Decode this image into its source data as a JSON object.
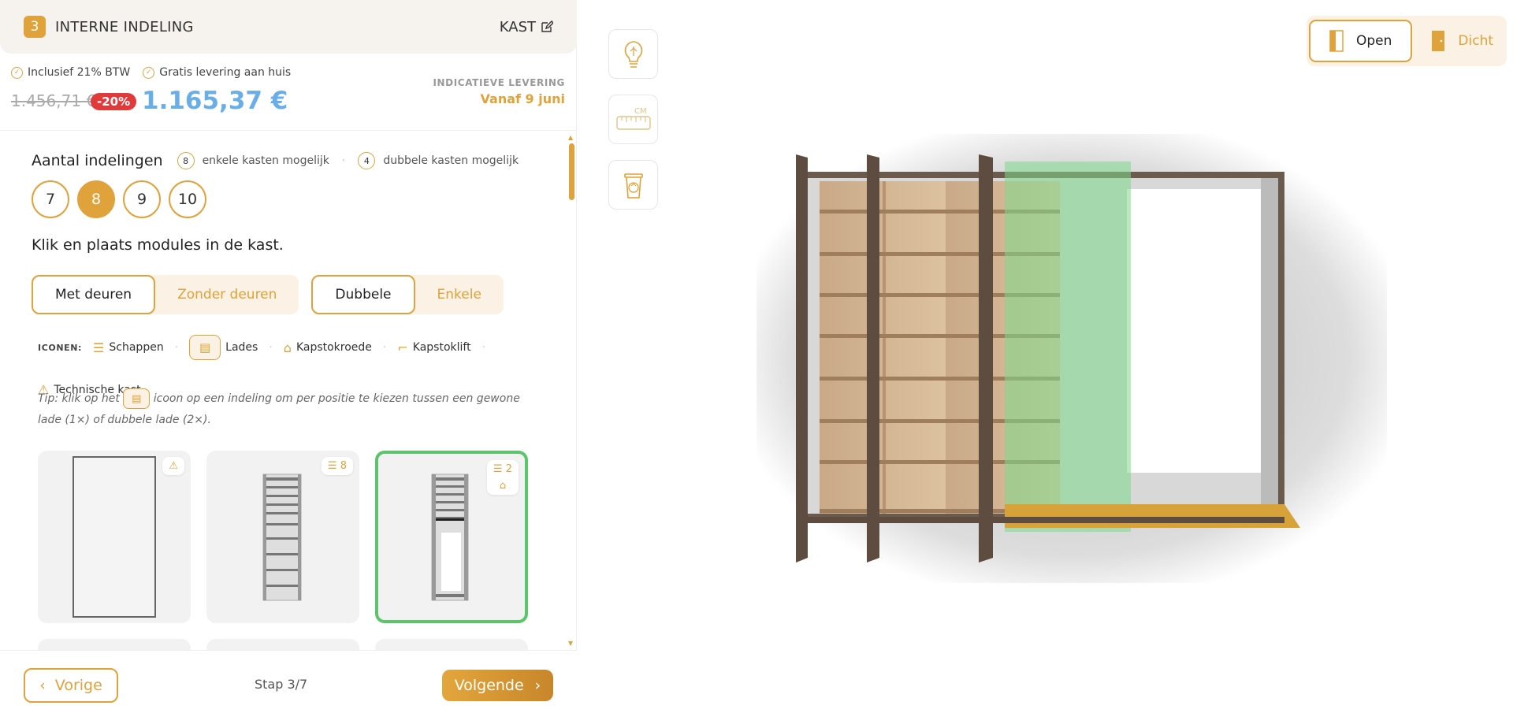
{
  "header": {
    "step_number": "3",
    "title": "INTERNE INDELING",
    "right_label": "KAST"
  },
  "price": {
    "incl_btw": "Inclusief 21% BTW",
    "gratis": "Gratis levering aan huis",
    "old": "1.456,71 €",
    "discount": "-20%",
    "new": "1.165,37 €",
    "delivery_label": "INDICATIEVE LEVERING",
    "delivery_date": "Vanaf 9 juni"
  },
  "indelingen": {
    "title": "Aantal indelingen",
    "single_count": "8",
    "single_text": "enkele kasten mogelijk",
    "double_count": "4",
    "double_text": "dubbele kasten mogelijk",
    "options": [
      "7",
      "8",
      "9",
      "10"
    ],
    "selected": "8"
  },
  "instruction": "Klik en plaats modules in de kast.",
  "door_toggle": {
    "on": "Met deuren",
    "off": "Zonder deuren"
  },
  "type_toggle": {
    "on": "Dubbele",
    "off": "Enkele"
  },
  "icons_legend": {
    "label": "ICONEN:",
    "schappen": "Schappen",
    "lades": "Lades",
    "kapstokroede": "Kapstokroede",
    "kapstoklift": "Kapstoklift",
    "technisch": "Technische kast"
  },
  "tip": {
    "part1": "Tip: klik op het",
    "part2": "icoon op een indeling om per positie te kiezen tussen een gewone lade (1×) of dubbele lade (2×)."
  },
  "modules": [
    {
      "badge_icon": "warning-icon",
      "badge_count": ""
    },
    {
      "badge_icon": "shelves-icon",
      "badge_count": "8"
    },
    {
      "badge_icon": "shelves-icon",
      "badge_count": "2",
      "extra_icon": "hanger-icon",
      "selected": true
    }
  ],
  "footer": {
    "prev": "Vorige",
    "step": "Stap 3/7",
    "next": "Volgende"
  },
  "tools": {
    "cm_label": "CM"
  },
  "view_toggle": {
    "open": "Open",
    "closed": "Dicht"
  },
  "colors": {
    "accent": "#e0a23a",
    "price_blue": "#6aaee8",
    "discount_red": "#e03a3a",
    "selected_green": "#5cc46b"
  }
}
